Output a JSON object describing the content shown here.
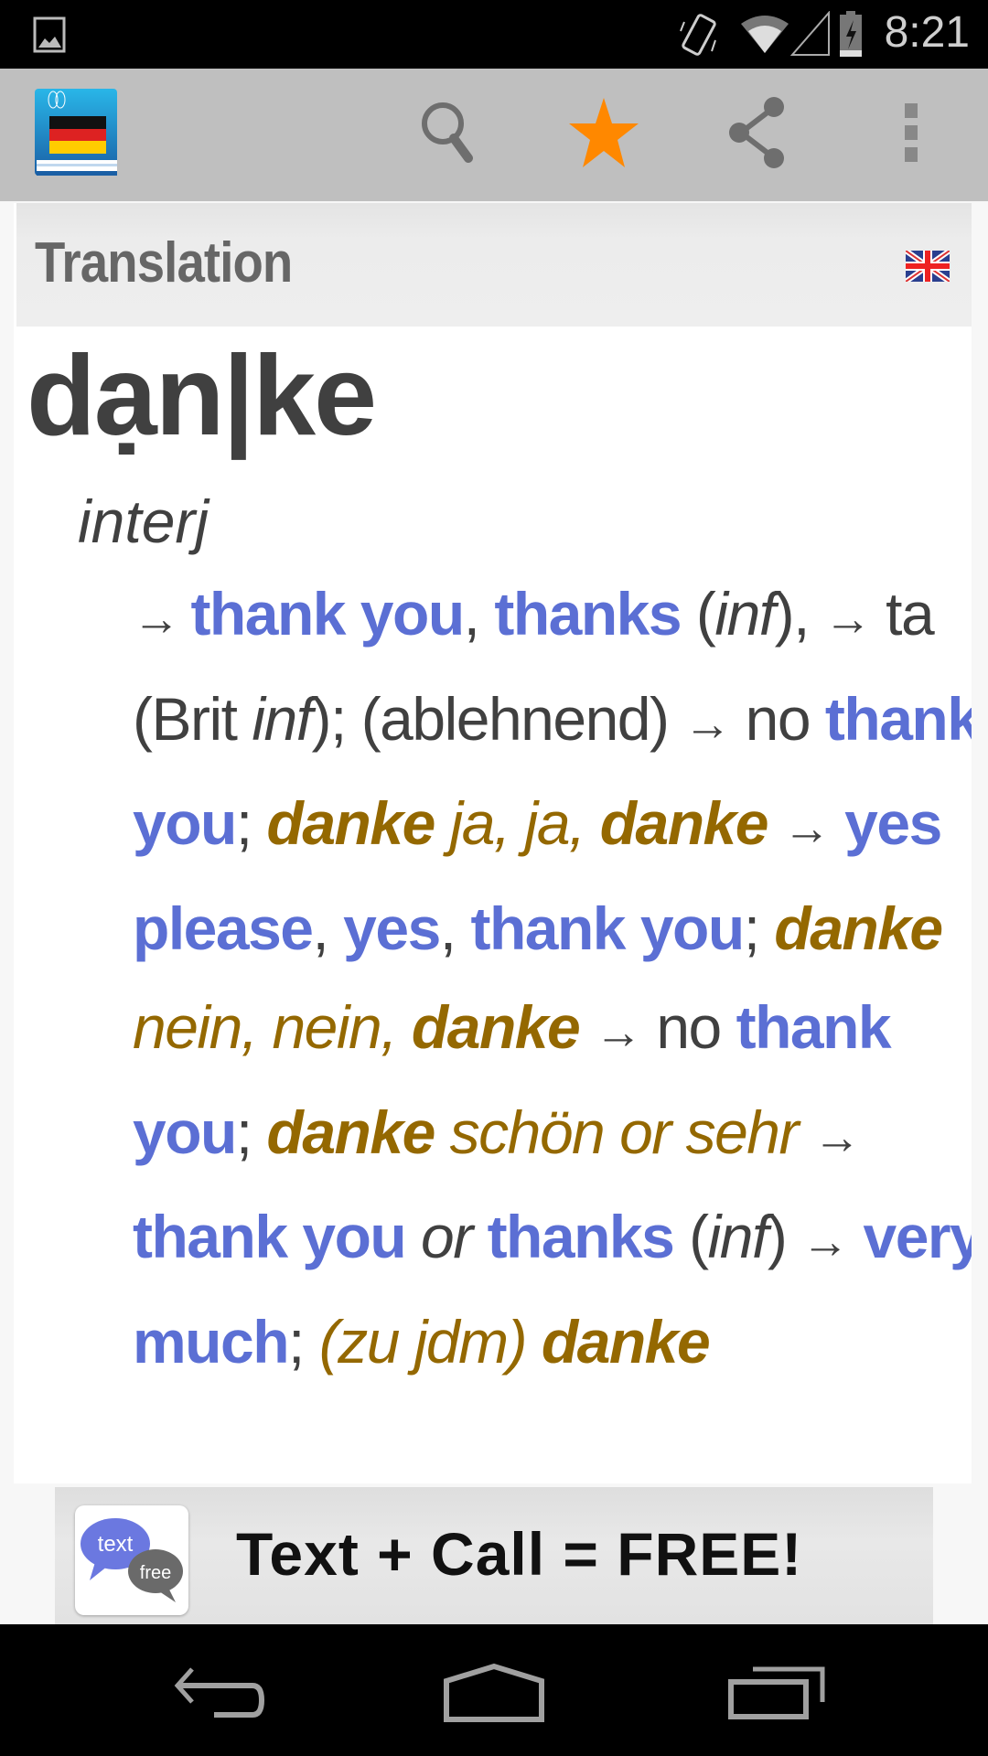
{
  "status_bar": {
    "time": "8:21",
    "icons": [
      "gallery-notification-icon",
      "screen-rotation-icon",
      "wifi-icon",
      "cell-signal-icon",
      "battery-charging-icon"
    ]
  },
  "action_bar": {
    "app_icon": "german-dictionary-app-icon",
    "actions": [
      {
        "name": "search",
        "icon": "search-icon"
      },
      {
        "name": "favorite",
        "icon": "star-icon",
        "active": true,
        "color": "#ff8800"
      },
      {
        "name": "share",
        "icon": "share-icon"
      },
      {
        "name": "overflow-menu",
        "icon": "more-vert-icon"
      }
    ]
  },
  "card": {
    "title": "Translation",
    "language_flag": "uk-flag-icon"
  },
  "entry": {
    "headword": "dạn|ke",
    "part_of_speech": "interj",
    "segments": [
      {
        "t": "→ ",
        "s": "arrow"
      },
      {
        "t": "thank you",
        "s": "tr"
      },
      {
        "t": ", "
      },
      {
        "t": "thanks",
        "s": "tr"
      },
      {
        "t": " ("
      },
      {
        "t": "inf",
        "s": "it"
      },
      {
        "t": "), "
      },
      {
        "t": "→",
        "s": "arrow"
      },
      {
        "t": " ta (Brit "
      },
      {
        "t": "inf",
        "s": "it"
      },
      {
        "t": "); (ablehnend) "
      },
      {
        "t": "→",
        "s": "arrow"
      },
      {
        "t": " no "
      },
      {
        "t": "thank you",
        "s": "tr"
      },
      {
        "t": "; "
      },
      {
        "t": "danke",
        "s": "exb"
      },
      {
        "t": " ja, ja, ",
        "s": "ex"
      },
      {
        "t": "danke",
        "s": "exb"
      },
      {
        "t": " "
      },
      {
        "t": "→",
        "s": "arrow"
      },
      {
        "t": " "
      },
      {
        "t": "yes please",
        "s": "tr"
      },
      {
        "t": ", "
      },
      {
        "t": "yes",
        "s": "tr"
      },
      {
        "t": ", "
      },
      {
        "t": "thank you",
        "s": "tr"
      },
      {
        "t": "; "
      },
      {
        "t": "danke",
        "s": "exb"
      },
      {
        "t": " nein, nein, ",
        "s": "ex"
      },
      {
        "t": "danke",
        "s": "exb"
      },
      {
        "t": " "
      },
      {
        "t": "→",
        "s": "arrow"
      },
      {
        "t": " no "
      },
      {
        "t": "thank you",
        "s": "tr"
      },
      {
        "t": "; "
      },
      {
        "t": "danke",
        "s": "exb"
      },
      {
        "t": " schön or sehr ",
        "s": "ex"
      },
      {
        "t": "→",
        "s": "arrow"
      },
      {
        "t": " "
      },
      {
        "t": "thank you",
        "s": "tr"
      },
      {
        "t": " or ",
        "s": "it"
      },
      {
        "t": "thanks",
        "s": "tr"
      },
      {
        "t": " ("
      },
      {
        "t": "inf",
        "s": "it"
      },
      {
        "t": ") "
      },
      {
        "t": "→",
        "s": "arrow"
      },
      {
        "t": " "
      },
      {
        "t": "very much",
        "s": "tr"
      },
      {
        "t": "; "
      },
      {
        "t": "(zu jdm) ",
        "s": "ex"
      },
      {
        "t": "danke",
        "s": "exb"
      }
    ]
  },
  "ad": {
    "logo_top": "text",
    "logo_bottom": "free",
    "text": "Text + Call = FREE!"
  },
  "nav_bar": {
    "buttons": [
      "back",
      "home",
      "recents"
    ]
  }
}
